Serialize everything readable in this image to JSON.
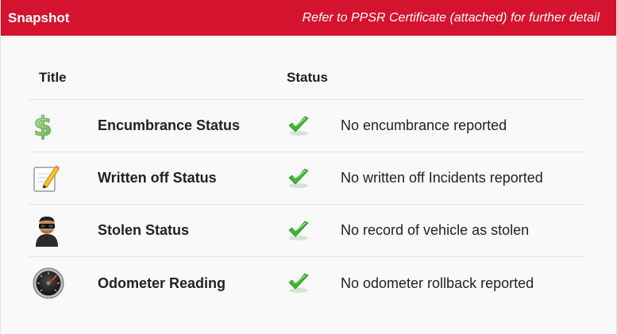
{
  "header": {
    "title": "Snapshot",
    "note": "Refer to PPSR Certificate (attached) for further detail"
  },
  "columns": {
    "title": "Title",
    "status": "Status"
  },
  "rows": [
    {
      "icon": "dollar-sign-icon",
      "title": "Encumbrance Status",
      "description": "No encumbrance reported"
    },
    {
      "icon": "notepad-pencil-icon",
      "title": "Written off Status",
      "description": "No written off Incidents reported"
    },
    {
      "icon": "thief-icon",
      "title": "Stolen Status",
      "description": "No record of vehicle as stolen"
    },
    {
      "icon": "speedometer-icon",
      "title": "Odometer Reading",
      "description": "No odometer rollback reported"
    }
  ],
  "colors": {
    "header_bg": "#d4132f",
    "check_green": "#3fb53a"
  }
}
